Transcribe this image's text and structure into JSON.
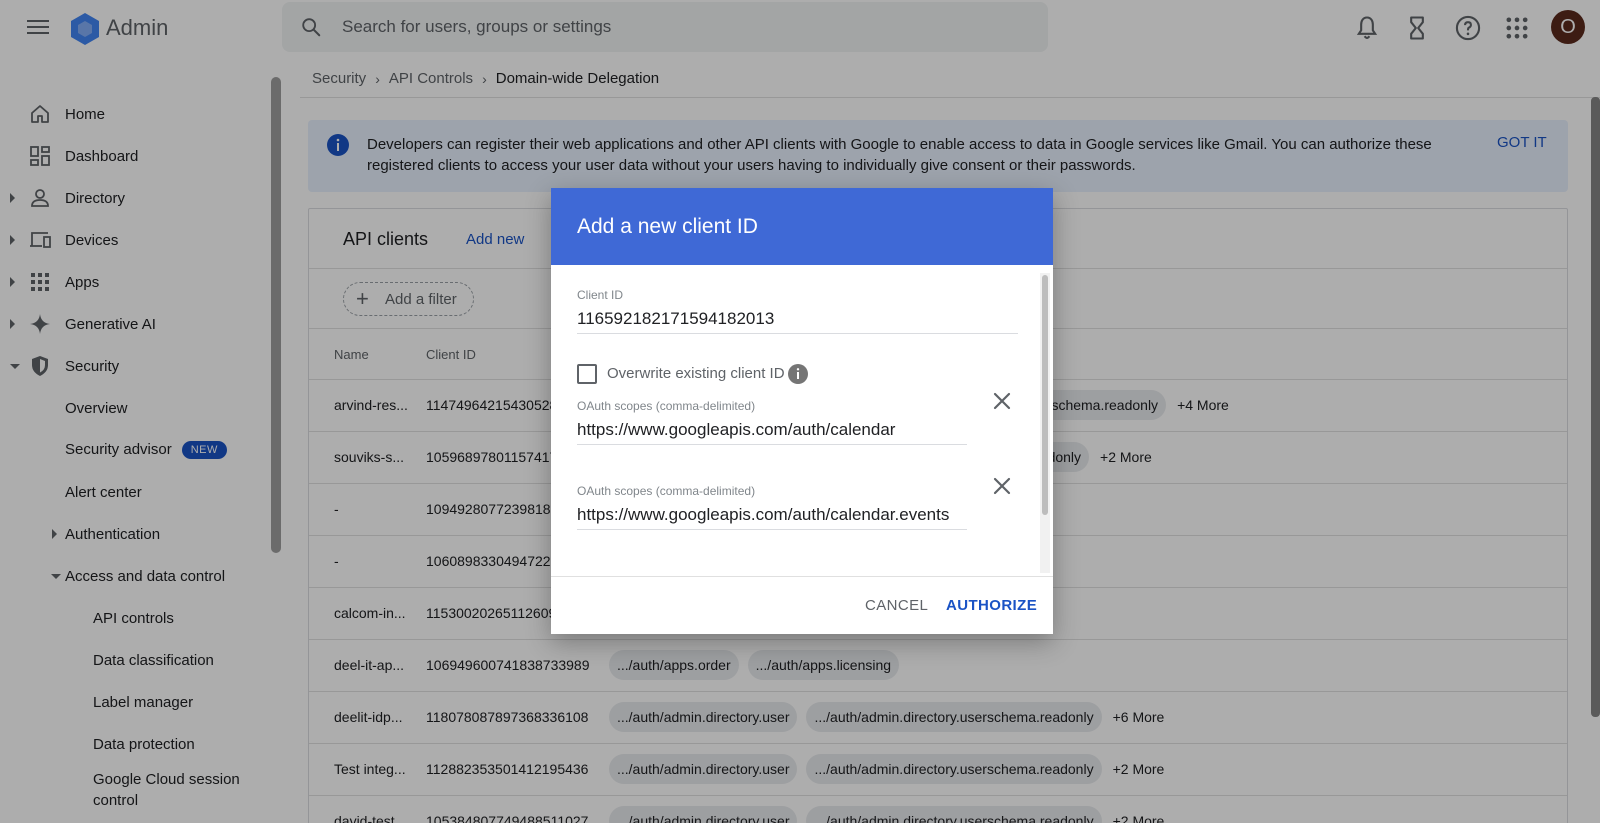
{
  "app": {
    "title": "Admin"
  },
  "search": {
    "placeholder": "Search for users, groups or settings"
  },
  "header": {
    "avatar_initial": "O"
  },
  "sidebar": {
    "items": [
      {
        "label": "Home"
      },
      {
        "label": "Dashboard"
      },
      {
        "label": "Directory"
      },
      {
        "label": "Devices"
      },
      {
        "label": "Apps"
      },
      {
        "label": "Generative AI"
      },
      {
        "label": "Security"
      },
      {
        "label": "Overview"
      },
      {
        "label": "Security advisor",
        "badge": "NEW"
      },
      {
        "label": "Alert center"
      },
      {
        "label": "Authentication"
      },
      {
        "label": "Access and data control"
      },
      {
        "label": "API controls"
      },
      {
        "label": "Data classification"
      },
      {
        "label": "Label manager"
      },
      {
        "label": "Data protection"
      },
      {
        "label": "Google Cloud session control"
      }
    ]
  },
  "breadcrumb": {
    "items": [
      "Security",
      "API Controls",
      "Domain-wide Delegation"
    ]
  },
  "banner": {
    "text": "Developers can register their web applications and other API clients with Google to enable access to data in Google services like Gmail. You can authorize these registered clients to access your user data without your users having to individually give consent or their passwords.",
    "action": "GOT IT"
  },
  "card": {
    "title": "API clients",
    "add_new": "Add new",
    "filter": "Add a filter",
    "columns": {
      "name": "Name",
      "client_id": "Client ID"
    }
  },
  "table": {
    "rows": [
      {
        "name": "arvind-res...",
        "client_id": "114749642154305287",
        "scopes": [
          "serschema.readonly"
        ],
        "more": "+4 More"
      },
      {
        "name": "souviks-s...",
        "client_id": "105968978011574171",
        "scopes": [
          "eadonly"
        ],
        "more": "+2 More"
      },
      {
        "name": "-",
        "client_id": "109492807723981811",
        "scopes": [],
        "more": ""
      },
      {
        "name": "-",
        "client_id": "106089833049472222",
        "scopes": [],
        "more": ""
      },
      {
        "name": "calcom-in...",
        "client_id": "115300202651126098",
        "scopes": [],
        "more": ""
      },
      {
        "name": "deel-it-ap...",
        "client_id": "106949600741838733989",
        "scopes": [
          ".../auth/apps.order",
          ".../auth/apps.licensing"
        ],
        "more": ""
      },
      {
        "name": "deelit-idp...",
        "client_id": "118078087897368336108",
        "scopes": [
          ".../auth/admin.directory.user",
          ".../auth/admin.directory.userschema.readonly"
        ],
        "more": "+6 More"
      },
      {
        "name": "Test integ...",
        "client_id": "112882353501412195436",
        "scopes": [
          ".../auth/admin.directory.user",
          ".../auth/admin.directory.userschema.readonly"
        ],
        "more": "+2 More"
      },
      {
        "name": "david-test...",
        "client_id": "105384807749488511027",
        "scopes": [
          ".../auth/admin.directory.user",
          ".../auth/admin.directory.userschema.readonly"
        ],
        "more": "+2 More"
      }
    ]
  },
  "dialog": {
    "title": "Add a new client ID",
    "client_id_label": "Client ID",
    "client_id_value": "116592182171594182013",
    "overwrite_label": "Overwrite existing client ID",
    "scope_label_1": "OAuth scopes (comma-delimited)",
    "scope_value_1": "https://www.googleapis.com/auth/calendar",
    "scope_label_2": "OAuth scopes (comma-delimited)",
    "scope_value_2": "https://www.googleapis.com/auth/calendar.events",
    "cancel": "CANCEL",
    "authorize": "AUTHORIZE"
  },
  "colors": {
    "accent": "#1a53c5",
    "dialog_header": "#3f69d6",
    "banner_bg": "#e8f0fe",
    "avatar_bg": "#5b2a1d"
  }
}
